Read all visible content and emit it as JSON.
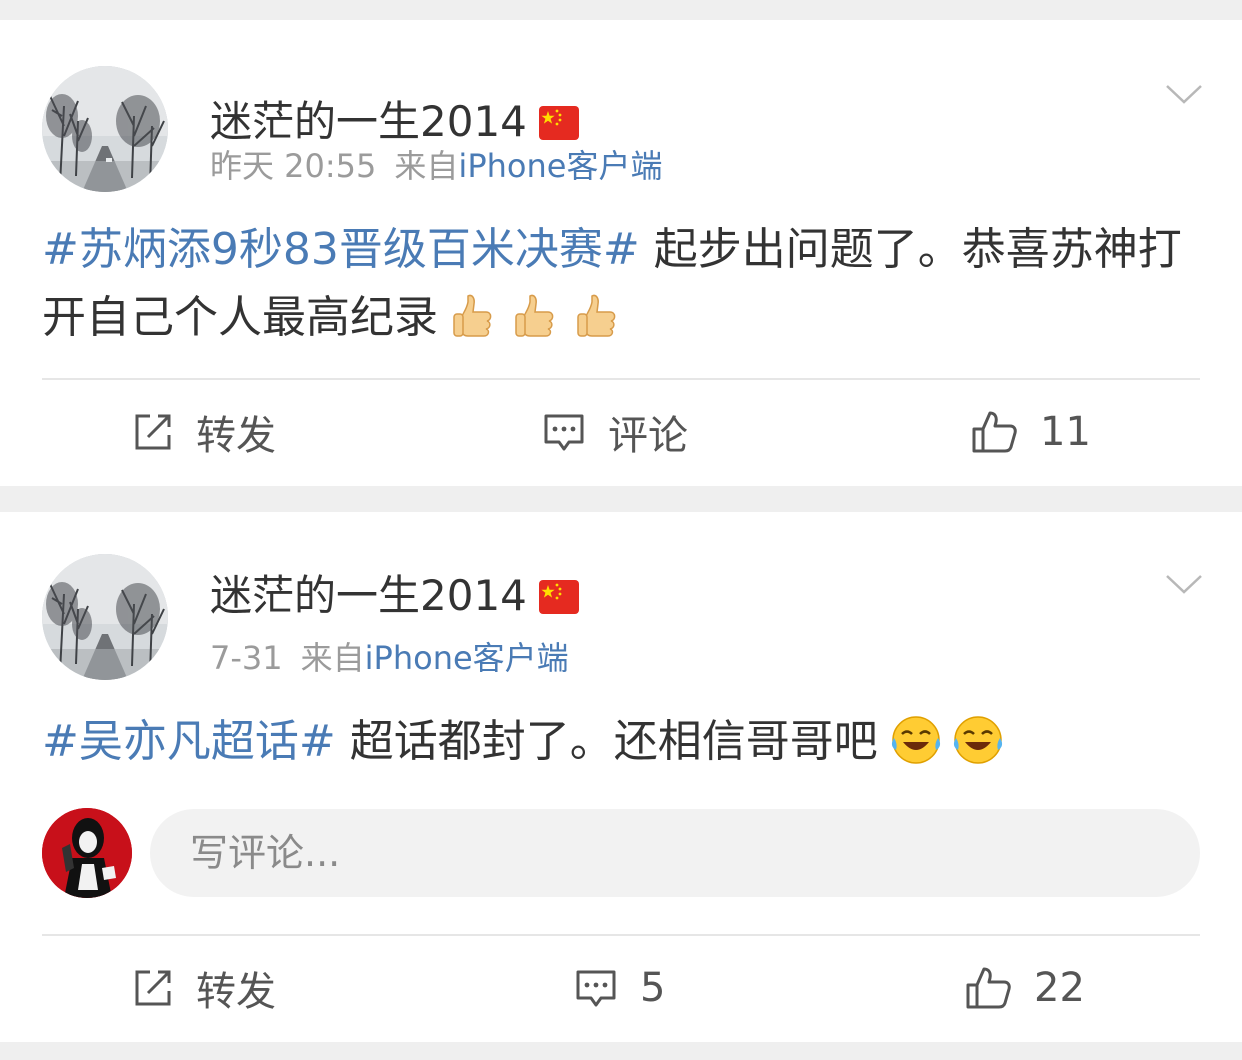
{
  "posts": [
    {
      "username": "迷茫的一生2014",
      "time": "昨天 20:55",
      "source_prefix": "来自",
      "source": "iPhone客户端",
      "topic": "#苏炳添9秒83晋级百米决赛#",
      "text": " 起步出问题了。恭喜苏神打开自己个人最高纪录",
      "emoji": [
        "thumbs-up",
        "thumbs-up",
        "thumbs-up"
      ],
      "actions": {
        "repost": "转发",
        "comment": "评论",
        "like": "11"
      }
    },
    {
      "username": "迷茫的一生2014",
      "time": "7-31",
      "source_prefix": "来自",
      "source": "iPhone客户端",
      "topic": "#吴亦凡超话#",
      "text": " 超话都封了。还相信哥哥吧",
      "emoji": [
        "laugh-cry",
        "laugh-cry"
      ],
      "comment_placeholder": "写评论...",
      "actions": {
        "repost": "转发",
        "comment": "5",
        "like": "22"
      }
    }
  ],
  "colors": {
    "link": "#4a7bb5",
    "text": "#333333",
    "meta": "#9b9b9b",
    "background": "#efefef"
  }
}
